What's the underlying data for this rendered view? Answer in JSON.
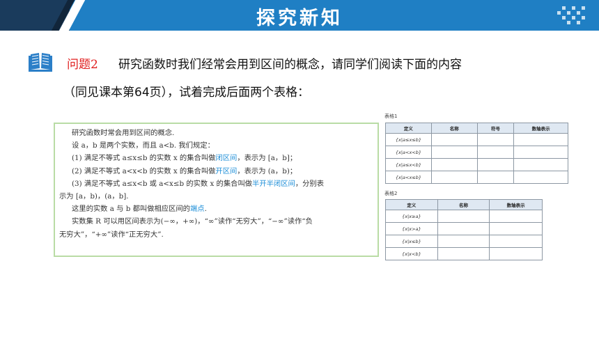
{
  "header": {
    "title": "探究新知"
  },
  "question": {
    "label": "问题2",
    "line1": "研究函数时我们经常会用到区间的概念，请同学们阅读下面的内容",
    "line2": "（同见课本第64页），试着完成后面两个表格："
  },
  "excerpt": {
    "lines": [
      "研究函数时常会用到区间的概念.",
      "设 a，b 是两个实数，而且 a<b. 我们规定：",
      "(1) 满足不等式 a≤x≤b 的实数 x 的集合叫做",
      "(2) 满足不等式 a<x<b 的实数 x 的集合叫做",
      "(3) 满足不等式 a≤x<b 或 a<x≤b 的实数 x 的集合叫做",
      "示为 [a，b)，(a，b].",
      "这里的实数 a 与 b 都叫做相应区间的",
      "实数集 R 可以用区间表示为(−∞，+∞)，“∞”读作“无穷大”，“−∞”读作“负",
      "无穷大”，“+∞”读作“正无穷大”."
    ],
    "term_closed": "闭区间",
    "after_closed": "，表示为 [a，b]；",
    "term_open": "开区间",
    "after_open": "，表示为 (a，b)；",
    "term_half": "半开半闭区间",
    "after_half": "，分别表",
    "term_endpoint": "端点",
    "after_endpoint": "."
  },
  "table1": {
    "caption": "表格1",
    "headers": [
      "定义",
      "名称",
      "符号",
      "数轴表示"
    ],
    "rows": [
      "{x|a≤x≤b}",
      "{x|a<x<b}",
      "{x|a≤x<b}",
      "{x|a<x≤b}"
    ]
  },
  "table2": {
    "caption": "表格2",
    "headers": [
      "定义",
      "名称",
      "数轴表示"
    ],
    "rows": [
      "{x|x≥a}",
      "{x|x>a}",
      "{x|x≤b}",
      "{x|x<b}"
    ]
  },
  "colors": {
    "banner": "#1f7fc4",
    "question_label": "#e02020",
    "highlight_term": "#1f8fd8",
    "excerpt_border": "#b9dca5"
  },
  "icons": [
    "open-book-icon",
    "dot-pattern-icon"
  ]
}
